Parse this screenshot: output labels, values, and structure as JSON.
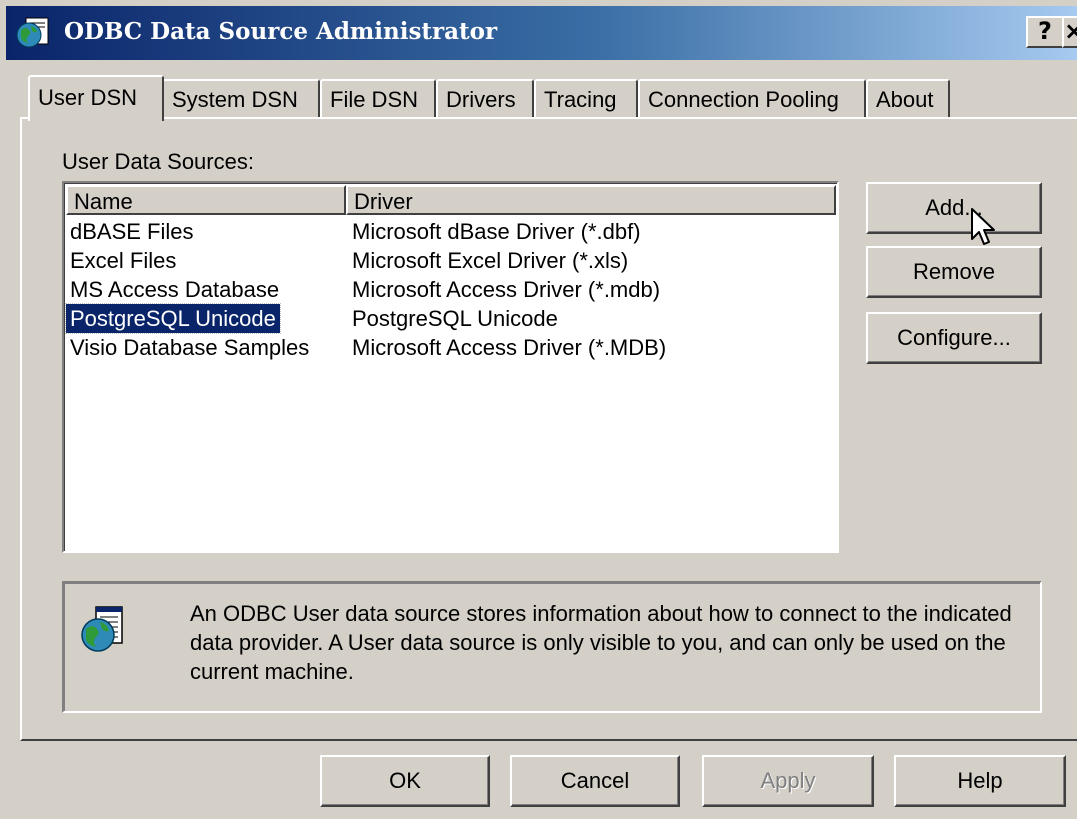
{
  "window": {
    "title": "ODBC Data Source Administrator",
    "help_button": "?",
    "close_button": "×"
  },
  "tabs": [
    {
      "label": "User DSN",
      "active": true
    },
    {
      "label": "System DSN"
    },
    {
      "label": "File DSN"
    },
    {
      "label": "Drivers"
    },
    {
      "label": "Tracing"
    },
    {
      "label": "Connection Pooling"
    },
    {
      "label": "About"
    }
  ],
  "user_dsn": {
    "section_label": "User Data Sources:",
    "columns": [
      "Name",
      "Driver"
    ],
    "rows": [
      {
        "name": "dBASE Files",
        "driver": "Microsoft dBase Driver (*.dbf)"
      },
      {
        "name": "Excel Files",
        "driver": "Microsoft Excel Driver (*.xls)"
      },
      {
        "name": "MS Access Database",
        "driver": "Microsoft Access Driver (*.mdb)"
      },
      {
        "name": "PostgreSQL Unicode",
        "driver": "PostgreSQL Unicode",
        "selected": true
      },
      {
        "name": "Visio Database Samples",
        "driver": "Microsoft Access Driver (*.MDB)"
      }
    ],
    "buttons": {
      "add": "Add...",
      "remove": "Remove",
      "configure": "Configure..."
    },
    "info_text": "An ODBC User data source stores information about how to connect to the indicated data provider.  A User data source is only visible to you, and can only be used on the current machine."
  },
  "footer": {
    "ok": "OK",
    "cancel": "Cancel",
    "apply": "Apply",
    "help": "Help"
  },
  "colors": {
    "title_start": "#0a246a",
    "title_end": "#a6caf0",
    "face": "#d4d0c8",
    "selection": "#0a246a"
  }
}
